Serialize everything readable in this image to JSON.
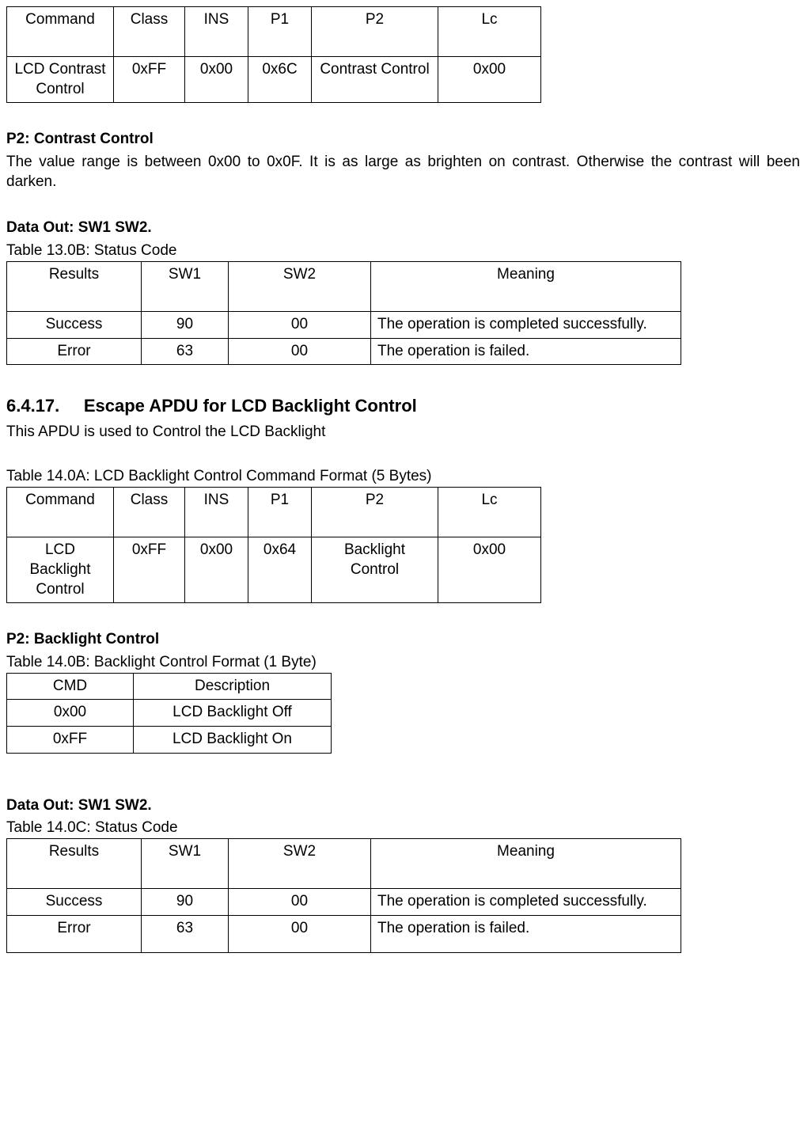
{
  "table13A": {
    "headers": [
      "Command",
      "Class",
      "INS",
      "P1",
      "P2",
      "Lc"
    ],
    "row": [
      "LCD Contrast Control",
      "0xFF",
      "0x00",
      "0x6C",
      "Contrast Control",
      "0x00"
    ]
  },
  "p2_contrast": {
    "title": "P2: Contrast Control",
    "body": "The value range is between 0x00 to 0x0F. It is as large as brighten on contrast. Otherwise the contrast will been darken."
  },
  "dataout13": {
    "title": "Data Out: SW1 SW2.",
    "caption": "Table 13.0B: Status Code",
    "headers": [
      "Results",
      "SW1",
      "SW2",
      "Meaning"
    ],
    "rows": [
      [
        "Success",
        "90",
        "00",
        "The operation is completed successfully."
      ],
      [
        "Error",
        "63",
        "00",
        "The operation is failed."
      ]
    ]
  },
  "section": {
    "num": "6.4.17.",
    "title": "Escape APDU for LCD Backlight Control",
    "intro": "This APDU is used to Control the LCD Backlight"
  },
  "table14A": {
    "caption": "Table 14.0A: LCD Backlight Control Command Format (5 Bytes)",
    "headers": [
      "Command",
      "Class",
      "INS",
      "P1",
      "P2",
      "Lc"
    ],
    "row": [
      "LCD Backlight Control",
      "0xFF",
      "0x00",
      "0x64",
      "Backlight Control",
      "0x00"
    ]
  },
  "p2_backlight": {
    "title": "P2: Backlight Control",
    "caption": "Table 14.0B: Backlight Control Format (1 Byte)",
    "headers": [
      "CMD",
      "Description"
    ],
    "rows": [
      [
        "0x00",
        "LCD Backlight Off"
      ],
      [
        "0xFF",
        "LCD Backlight On"
      ]
    ]
  },
  "dataout14": {
    "title": "Data Out: SW1 SW2.",
    "caption": "Table 14.0C: Status Code",
    "headers": [
      "Results",
      "SW1",
      "SW2",
      "Meaning"
    ],
    "rows": [
      [
        "Success",
        "90",
        "00",
        "The operation is completed successfully."
      ],
      [
        "Error",
        "63",
        "00",
        "The operation is failed."
      ]
    ]
  }
}
